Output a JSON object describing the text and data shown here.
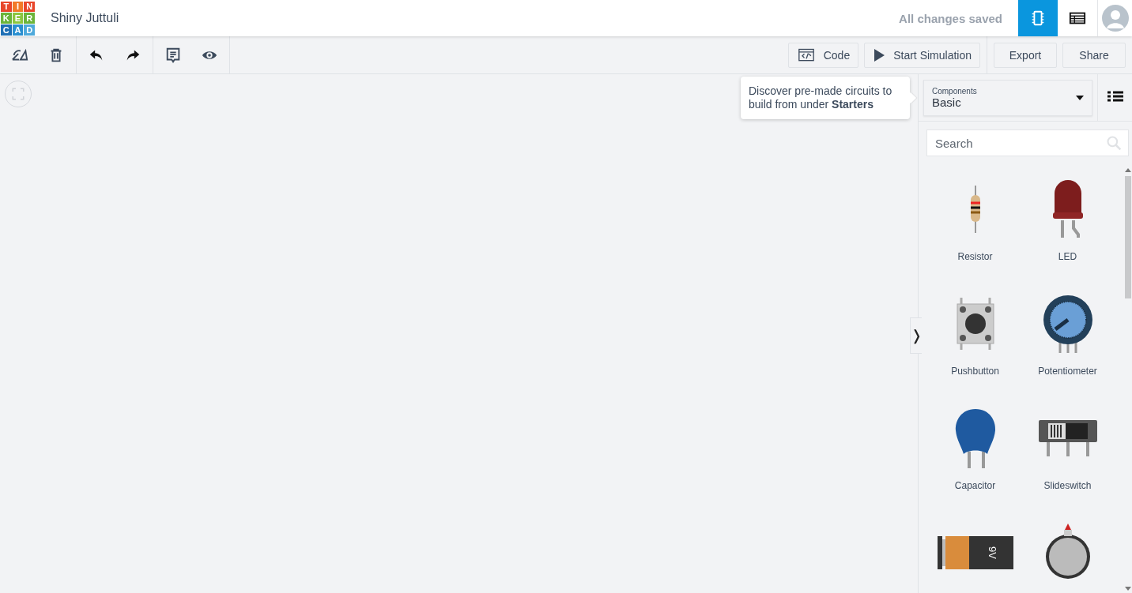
{
  "logo": {
    "letters": [
      {
        "text": "T",
        "color": "#e8462b"
      },
      {
        "text": "I",
        "color": "#f27a28"
      },
      {
        "text": "N",
        "color": "#e8462b"
      },
      {
        "text": "K",
        "color": "#6bb43a"
      },
      {
        "text": "E",
        "color": "#8cc63f"
      },
      {
        "text": "R",
        "color": "#6bb43a"
      },
      {
        "text": "C",
        "color": "#1f6fb5"
      },
      {
        "text": "A",
        "color": "#2a8fd0"
      },
      {
        "text": "D",
        "color": "#4fa9db"
      }
    ]
  },
  "project_title": "Shiny Juttuli",
  "save_status": "All changes saved",
  "view_buttons": [
    {
      "kind": "circuit",
      "selected": true
    },
    {
      "kind": "schematic",
      "selected": false
    }
  ],
  "toolbar": {
    "actions": [
      {
        "kind": "rotate"
      },
      {
        "kind": "delete"
      },
      {
        "kind": "undo"
      },
      {
        "kind": "redo"
      },
      {
        "kind": "notes"
      },
      {
        "kind": "visibility"
      }
    ],
    "buttons": [
      {
        "kind": "code",
        "label": "Code"
      },
      {
        "kind": "simulate",
        "label": "Start Simulation"
      },
      {
        "kind": "plain",
        "label": "Export"
      },
      {
        "kind": "plain",
        "label": "Share"
      }
    ]
  },
  "tooltip": {
    "text": "Discover pre-made circuits to build from under **Starters**"
  },
  "panel": {
    "dropdown": {
      "label": "Components",
      "value": "Basic"
    },
    "search": {
      "placeholder": "Search"
    },
    "components": [
      {
        "kind": "resistor",
        "name": "Resistor"
      },
      {
        "kind": "led",
        "name": "LED"
      },
      {
        "kind": "pushbutton",
        "name": "Pushbutton"
      },
      {
        "kind": "potentiometer",
        "name": "Potentiometer"
      },
      {
        "kind": "capacitor",
        "name": "Capacitor"
      },
      {
        "kind": "slideswitch",
        "name": "Slideswitch"
      },
      {
        "kind": "battery9v",
        "print": "9V"
      },
      {
        "kind": "coinbattery"
      }
    ]
  },
  "collapse_tab": "❭"
}
